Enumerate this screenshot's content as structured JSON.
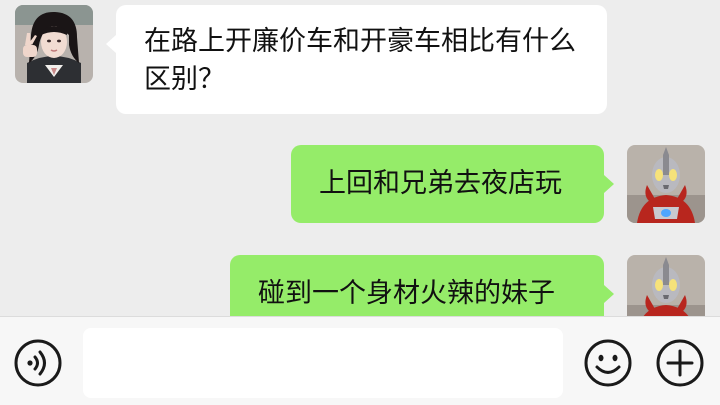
{
  "messages": [
    {
      "side": "incoming",
      "sender_avatar": "girl-avatar",
      "text": "在路上开廉价车和开豪车相比有什么区别？"
    },
    {
      "side": "outgoing",
      "sender_avatar": "ultraman-avatar",
      "text": "上回和兄弟去夜店玩"
    },
    {
      "side": "outgoing",
      "sender_avatar": "ultraman-avatar",
      "text": "碰到一个身材火辣的妹子"
    }
  ],
  "input": {
    "value": "",
    "placeholder": ""
  },
  "colors": {
    "background": "#ededed",
    "incoming_bubble": "#ffffff",
    "outgoing_bubble": "#95ec69",
    "input_bar": "#f7f7f7"
  },
  "icons": {
    "voice": "voice-icon",
    "emoji": "emoji-icon",
    "more": "plus-icon"
  }
}
